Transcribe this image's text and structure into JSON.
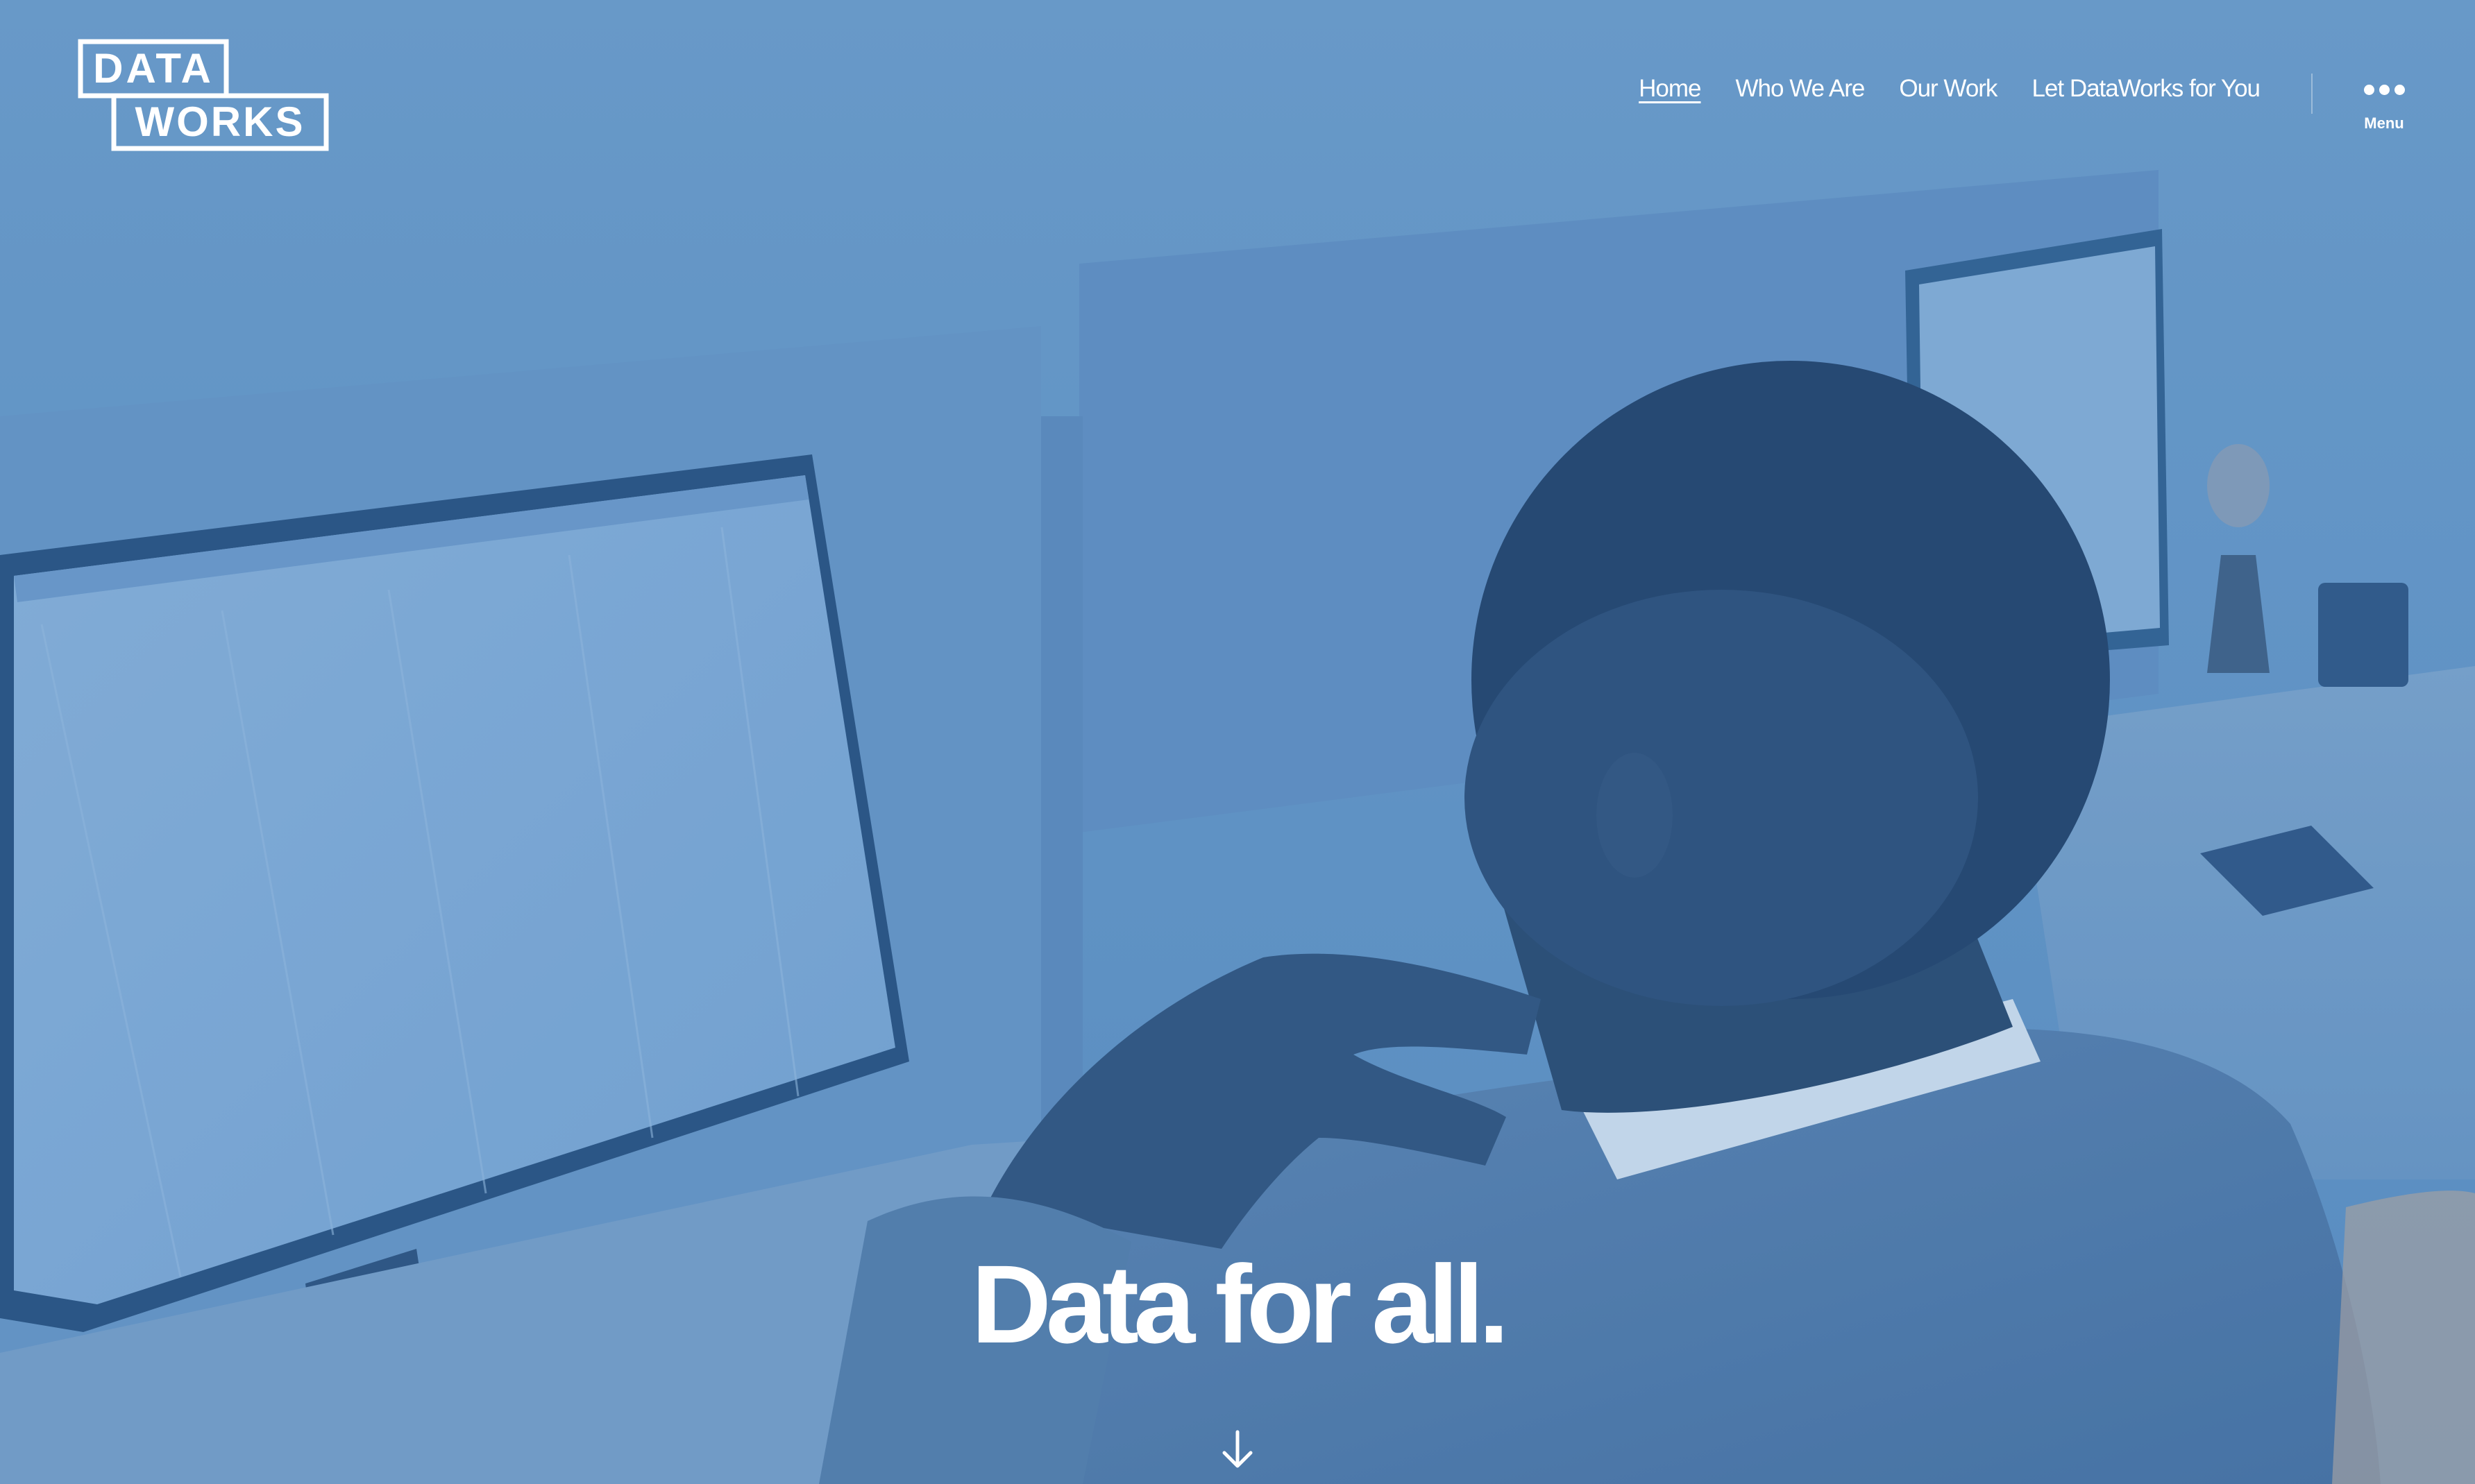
{
  "site": {
    "logo_line1": "DATA",
    "logo_line2": "WORKS"
  },
  "nav": {
    "items": [
      {
        "label": "Home",
        "active": true
      },
      {
        "label": "Who We Are",
        "active": false
      },
      {
        "label": "Our Work",
        "active": false
      },
      {
        "label": "Let DataWorks for You",
        "active": false
      }
    ],
    "menu_label": "Menu"
  },
  "hero": {
    "title": "Data for all.",
    "overlay_color": "#4a86c0"
  },
  "icons": {
    "menu": "more-dots-icon",
    "scroll": "arrow-down-icon"
  }
}
